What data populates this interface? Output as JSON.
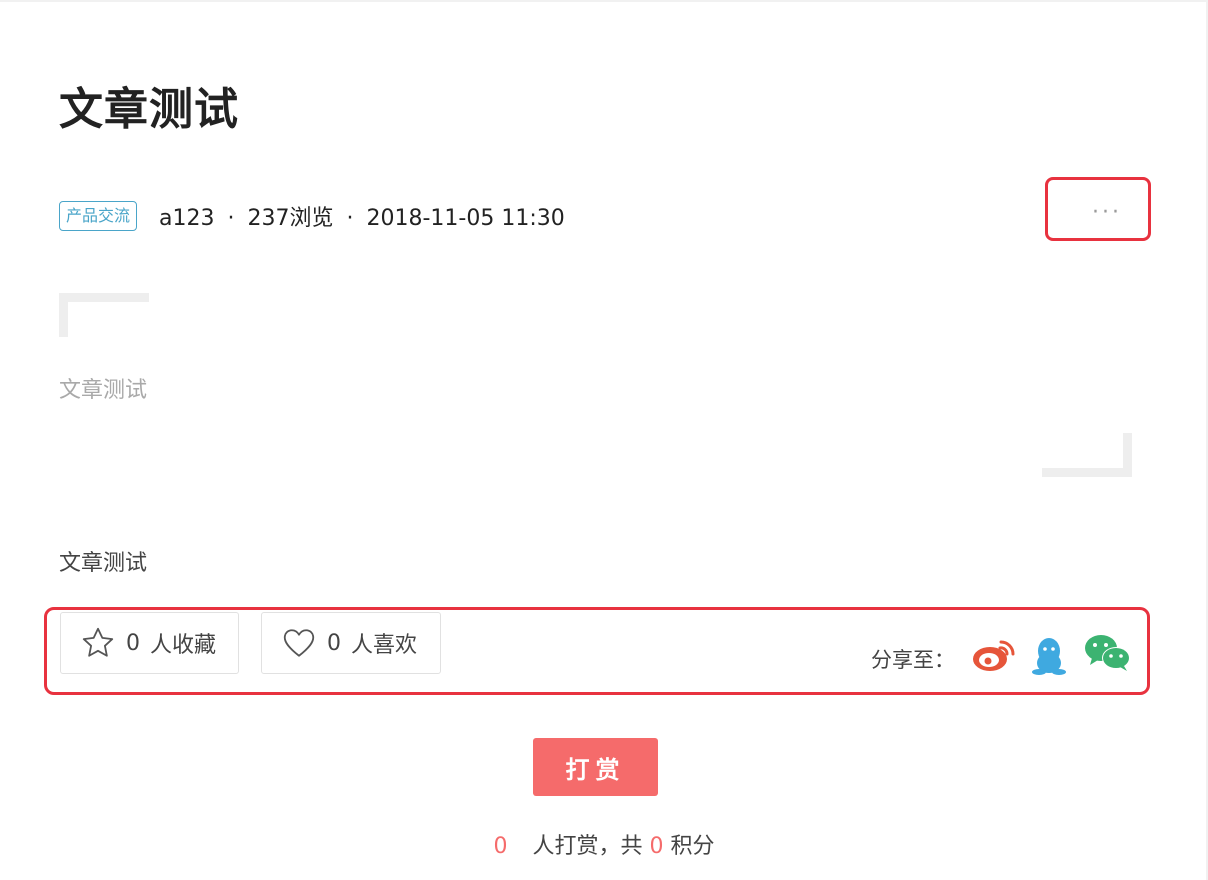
{
  "article": {
    "title": "文章测试",
    "category_tag": "产品交流",
    "author": "a123",
    "views": "237浏览",
    "date": "2018-11-05 11:30",
    "separator": "·",
    "more_label": "···",
    "quote": "文章测试",
    "body": "文章测试"
  },
  "actions": {
    "collect_count": "0",
    "collect_label": "人收藏",
    "like_count": "0",
    "like_label": "人喜欢",
    "share_label": "分享至："
  },
  "reward": {
    "button_label": "打赏",
    "count": "0",
    "text_mid": "人打赏，共",
    "points": "0",
    "text_end": "积分"
  },
  "colors": {
    "accent_red": "#f56b6b",
    "highlight_border": "#e8323f",
    "tag_blue": "#4aa5c9",
    "weibo": "#e6553a",
    "qq": "#3fa9e0",
    "wechat": "#3cb371"
  },
  "icons": {
    "collect": "star-icon",
    "like": "heart-icon",
    "weibo": "weibo-icon",
    "qq": "qq-icon",
    "wechat": "wechat-icon",
    "more": "ellipsis-icon"
  }
}
